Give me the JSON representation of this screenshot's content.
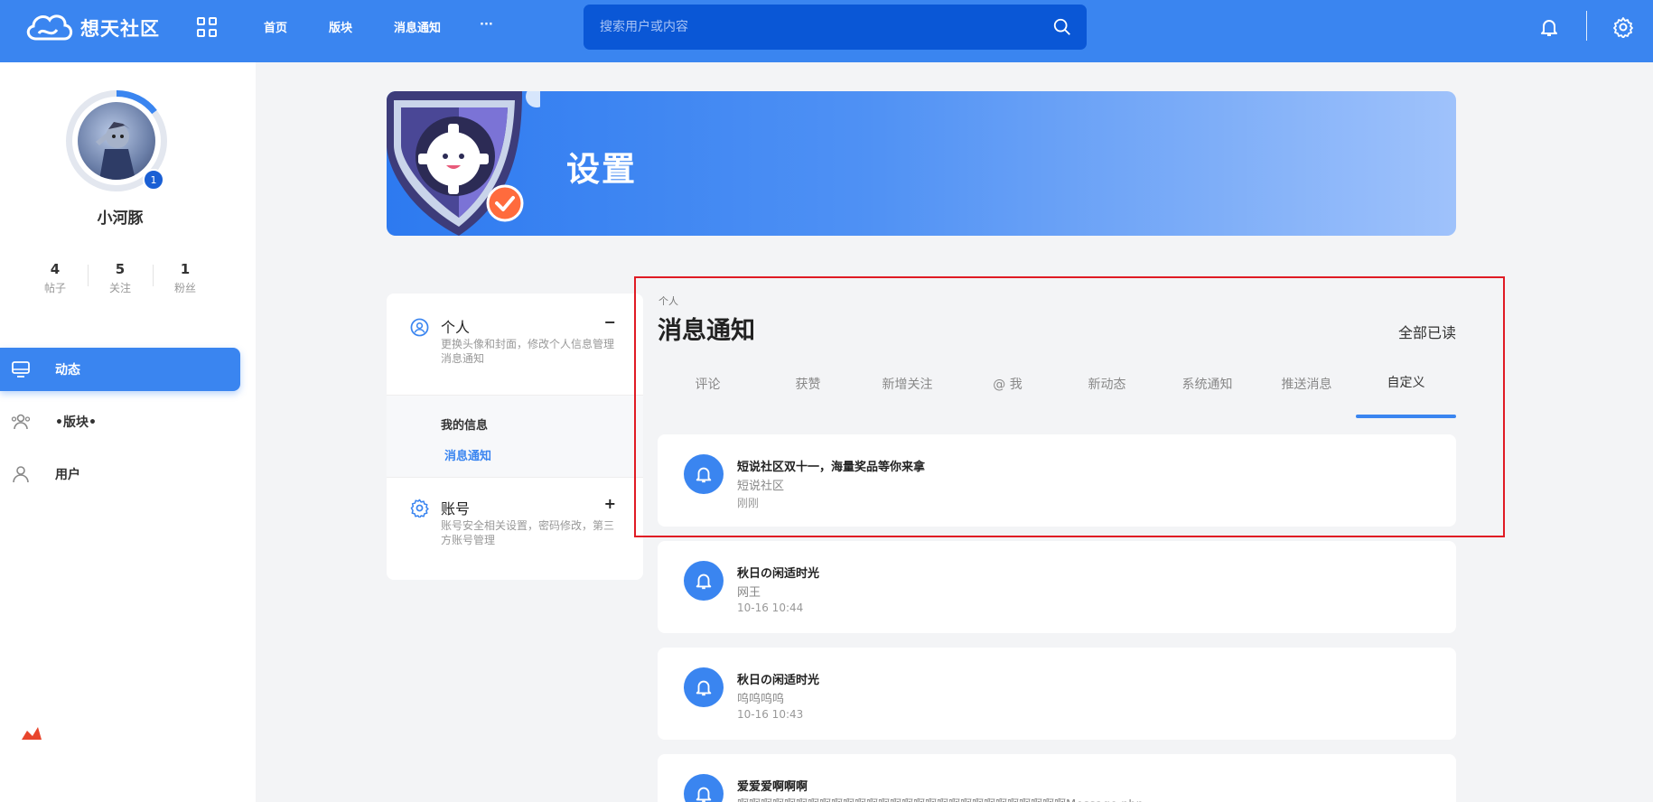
{
  "app": {
    "brand": "想天社区"
  },
  "nav": {
    "items": [
      "首页",
      "版块",
      "消息通知",
      "···"
    ]
  },
  "search": {
    "placeholder": "搜索用户或内容"
  },
  "profile": {
    "avatar_badge": "1",
    "name": "小河豚",
    "stats": [
      {
        "value": "4",
        "label": "帖子"
      },
      {
        "value": "5",
        "label": "关注"
      },
      {
        "value": "1",
        "label": "粉丝"
      }
    ]
  },
  "sidebar": {
    "items": [
      {
        "label": "动态",
        "icon": "monitor-icon",
        "active": true
      },
      {
        "label": "•版块•",
        "icon": "users-icon",
        "active": false
      },
      {
        "label": "用户",
        "icon": "user-icon",
        "active": false
      }
    ]
  },
  "banner": {
    "title": "设置"
  },
  "settings_menu": {
    "personal": {
      "title": "个人",
      "toggle": "−",
      "desc": "更换头像和封面，修改个人信息管理消息通知",
      "subitems": [
        "我的信息",
        "消息通知"
      ]
    },
    "account": {
      "title": "账号",
      "toggle": "+",
      "desc": "账号安全相关设置，密码修改，第三方账号管理"
    }
  },
  "notifications": {
    "category": "个人",
    "title": "消息通知",
    "mark_all_read": "全部已读",
    "tabs": [
      "评论",
      "获赞",
      "新增关注",
      "@ 我",
      "新动态",
      "系统通知",
      "推送消息",
      "自定义"
    ],
    "active_tab": "自定义",
    "items": [
      {
        "title": "短说社区双十一，海量奖品等你来拿",
        "from": "短说社区",
        "time": "刚刚"
      },
      {
        "title": "秋日の闲适时光",
        "from": "网王",
        "time": "10-16 10:44"
      },
      {
        "title": "秋日の闲适时光",
        "from": "呜呜呜呜",
        "time": "10-16 10:43"
      },
      {
        "title": "爱爱爱啊啊啊",
        "from": "啊啊啊啊啊啊啊啊啊啊啊啊啊啊啊啊啊啊啊啊啊啊啊啊啊啊啊啊Message.php",
        "time": ""
      }
    ]
  },
  "colors": {
    "primary": "#3a85f0",
    "search_bg": "#0a57d6",
    "highlight": "#e01b24"
  }
}
